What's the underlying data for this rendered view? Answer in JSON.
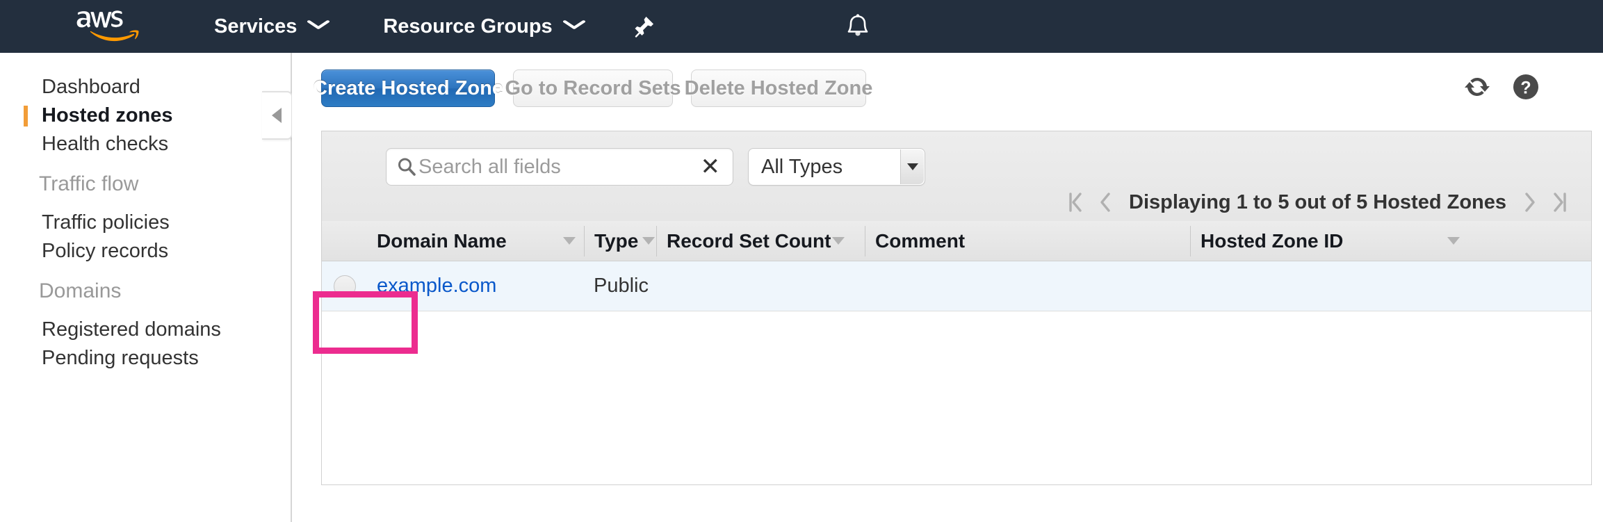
{
  "topnav": {
    "logo_alt": "aws",
    "services_label": "Services",
    "resource_groups_label": "Resource Groups",
    "pin_icon": "pin-icon",
    "bell_icon": "bell-icon",
    "caret": "⌄"
  },
  "sidebar": {
    "items": [
      {
        "label": "Dashboard",
        "active": false
      },
      {
        "label": "Hosted zones",
        "active": true
      },
      {
        "label": "Health checks",
        "active": false
      }
    ],
    "sections": [
      {
        "title": "Traffic flow",
        "items": [
          {
            "label": "Traffic policies"
          },
          {
            "label": "Policy records"
          }
        ]
      },
      {
        "title": "Domains",
        "items": [
          {
            "label": "Registered domains"
          },
          {
            "label": "Pending requests"
          }
        ]
      }
    ],
    "collapse_icon": "collapse-left-icon"
  },
  "toolbar": {
    "create_label": "Create Hosted Zone",
    "goto_records_label": "Go to Record Sets",
    "delete_label": "Delete Hosted Zone",
    "refresh_icon": "refresh-icon",
    "help_icon": "help-icon"
  },
  "search": {
    "placeholder": "Search all fields",
    "value": "",
    "search_icon": "search-icon",
    "clear_icon": "clear-x-icon",
    "type_filter_value": "All Types"
  },
  "pagination": {
    "first_icon": "first-page-icon",
    "prev_icon": "prev-page-icon",
    "next_icon": "next-page-icon",
    "last_icon": "last-page-icon",
    "status": "Displaying 1 to 5 out of 5 Hosted Zones"
  },
  "table": {
    "columns": [
      {
        "label": "Domain Name",
        "sortable": true
      },
      {
        "label": "Type",
        "sortable": true
      },
      {
        "label": "Record Set Count",
        "sortable": true
      },
      {
        "label": "Comment",
        "sortable": false
      },
      {
        "label": "Hosted Zone ID",
        "sortable": true
      }
    ],
    "rows": [
      {
        "selected": false,
        "domain_name": "example.com",
        "type": "Public",
        "record_set_count": "",
        "comment": "",
        "hosted_zone_id": ""
      }
    ]
  },
  "annotation": {
    "color": "#ec2c8f",
    "target": "hosted-zone-row-domain-cell"
  },
  "colors": {
    "nav_background": "#232f3e",
    "accent_orange": "#f29d38",
    "primary_button": "#2d74bd",
    "link_blue": "#0a58ca",
    "row_selected": "#eff6fc",
    "annotation_pink": "#ec2c8f"
  }
}
